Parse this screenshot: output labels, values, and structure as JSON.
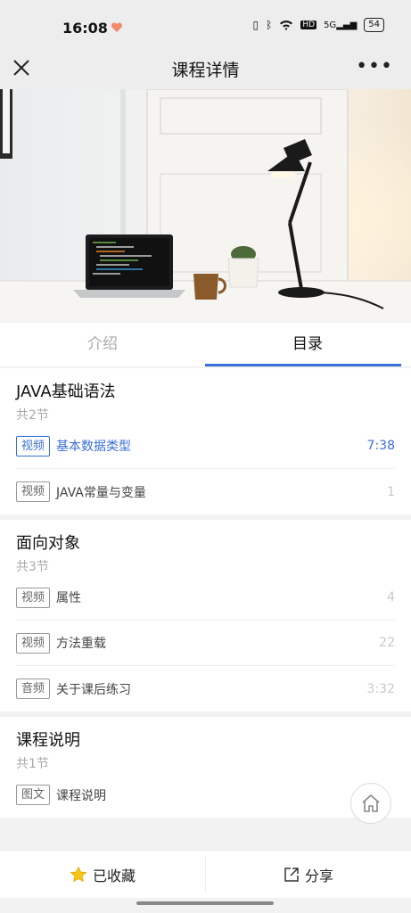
{
  "status_bar": {
    "time": "16:08",
    "network": "5G",
    "battery": "54",
    "hd_label": "HD"
  },
  "nav": {
    "title": "课程详情",
    "more": "•••"
  },
  "tabs": [
    {
      "label": "介绍",
      "active": false
    },
    {
      "label": "目录",
      "active": true
    }
  ],
  "chapters": [
    {
      "title": "JAVA基础语法",
      "count": "共2节",
      "lessons": [
        {
          "badge": "视频",
          "title": "基本数据类型",
          "meta": "7:38",
          "active": true
        },
        {
          "badge": "视频",
          "title": "JAVA常量与变量",
          "meta": "1",
          "active": false
        }
      ]
    },
    {
      "title": "面向对象",
      "count": "共3节",
      "lessons": [
        {
          "badge": "视频",
          "title": "属性",
          "meta": "4",
          "active": false
        },
        {
          "badge": "视频",
          "title": "方法重载",
          "meta": "22",
          "active": false
        },
        {
          "badge": "音频",
          "title": "关于课后练习",
          "meta": "3:32",
          "active": false
        }
      ]
    },
    {
      "title": "课程说明",
      "count": "共1节",
      "lessons": [
        {
          "badge": "图文",
          "title": "课程说明",
          "meta": "",
          "active": false
        }
      ]
    }
  ],
  "bottom": {
    "favorite_label": "已收藏",
    "share_label": "分享"
  },
  "colors": {
    "accent": "#3a6fd8",
    "star": "#f5c518"
  }
}
